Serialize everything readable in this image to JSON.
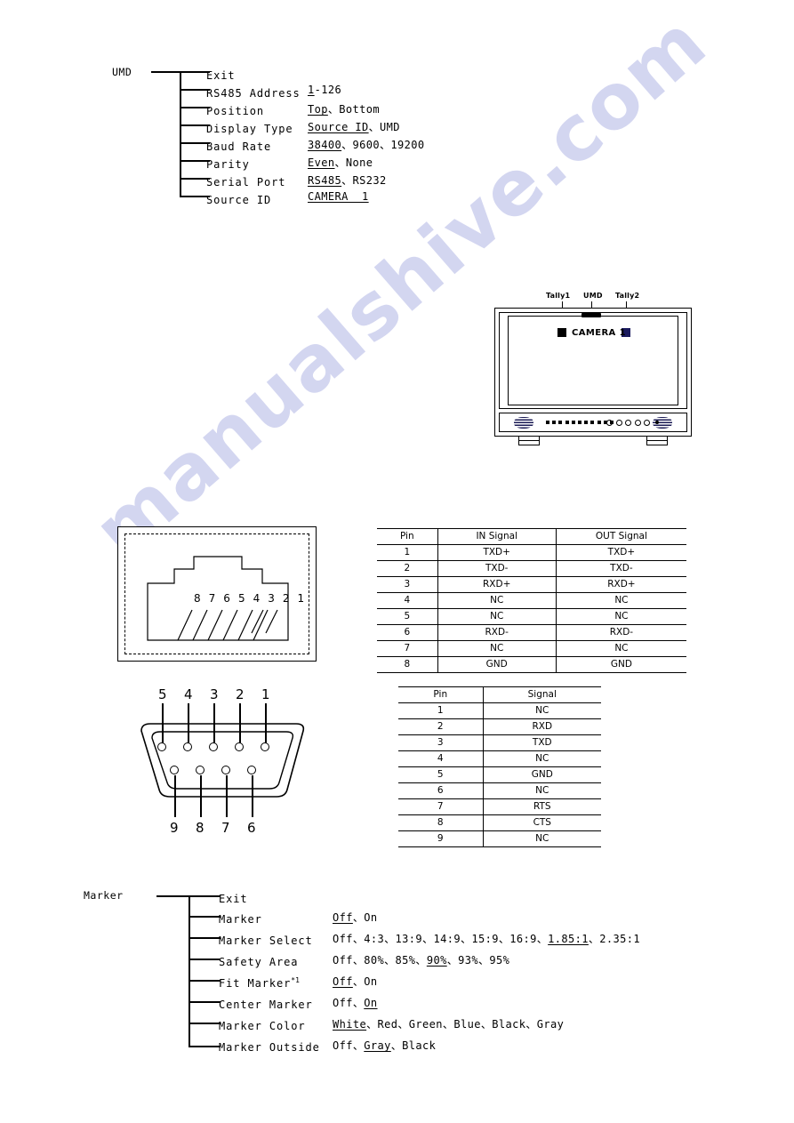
{
  "watermark": "manualshive.com",
  "umd_menu": {
    "root": "UMD",
    "rows": [
      {
        "label": "Exit",
        "values": ""
      },
      {
        "label": "RS485 Address",
        "values": "1-126",
        "underline": "1"
      },
      {
        "label": "Position",
        "values": "Top、Bottom",
        "underline": "Top"
      },
      {
        "label": "Display Type",
        "values": "Source ID、UMD",
        "underline": "Source ID"
      },
      {
        "label": "Baud Rate",
        "values": "38400、9600、19200",
        "underline": "38400"
      },
      {
        "label": "Parity",
        "values": "Even、None",
        "underline": "Even"
      },
      {
        "label": "Serial Port",
        "values": "RS485、RS232",
        "underline": "RS485"
      },
      {
        "label": "Source ID",
        "values": "CAMERA  1",
        "underline": "CAMERA  1"
      }
    ]
  },
  "monitor": {
    "callouts": {
      "tally1": "Tally1",
      "umd": "UMD",
      "tally2": "Tally2"
    },
    "screen_text": "CAMERA 1",
    "tally1_color": "#000000",
    "tally2_color": "#1a1a5e"
  },
  "rj45": {
    "pin_numbers": "8 7 6 5 4 3 2 1"
  },
  "db9": {
    "top_pins": [
      "5",
      "4",
      "3",
      "2",
      "1"
    ],
    "bottom_pins": [
      "9",
      "8",
      "7",
      "6"
    ]
  },
  "table_rj45": {
    "headers": [
      "Pin",
      "IN Signal",
      "OUT Signal"
    ],
    "rows": [
      [
        "1",
        "TXD+",
        "TXD+"
      ],
      [
        "2",
        "TXD-",
        "TXD-"
      ],
      [
        "3",
        "RXD+",
        "RXD+"
      ],
      [
        "4",
        "NC",
        "NC"
      ],
      [
        "5",
        "NC",
        "NC"
      ],
      [
        "6",
        "RXD-",
        "RXD-"
      ],
      [
        "7",
        "NC",
        "NC"
      ],
      [
        "8",
        "GND",
        "GND"
      ]
    ]
  },
  "table_db9": {
    "headers": [
      "Pin",
      "Signal"
    ],
    "rows": [
      [
        "1",
        "NC"
      ],
      [
        "2",
        "RXD"
      ],
      [
        "3",
        "TXD"
      ],
      [
        "4",
        "NC"
      ],
      [
        "5",
        "GND"
      ],
      [
        "6",
        "NC"
      ],
      [
        "7",
        "RTS"
      ],
      [
        "8",
        "CTS"
      ],
      [
        "9",
        "NC"
      ]
    ]
  },
  "marker_menu": {
    "root": "Marker",
    "rows": [
      {
        "label": "Exit",
        "values": ""
      },
      {
        "label": "Marker",
        "values": "Off、On",
        "underline": "Off"
      },
      {
        "label": "Marker Select",
        "values": "Off、4:3、13:9、14:9、15:9、16:9、1.85:1、2.35:1",
        "underline": "1.85:1"
      },
      {
        "label": "Safety Area",
        "values": "Off、80%、85%、90%、93%、95%",
        "underline": "90%"
      },
      {
        "label": "Fit Marker*1",
        "values": "Off、On",
        "underline": "Off"
      },
      {
        "label": "Center Marker",
        "values": "Off、On",
        "underline": "On"
      },
      {
        "label": "Marker Color",
        "values": "White、Red、Green、Blue、Black、Gray",
        "underline": "White"
      },
      {
        "label": "Marker Outside",
        "values": "Off、Gray、Black",
        "underline": "Gray"
      }
    ]
  }
}
